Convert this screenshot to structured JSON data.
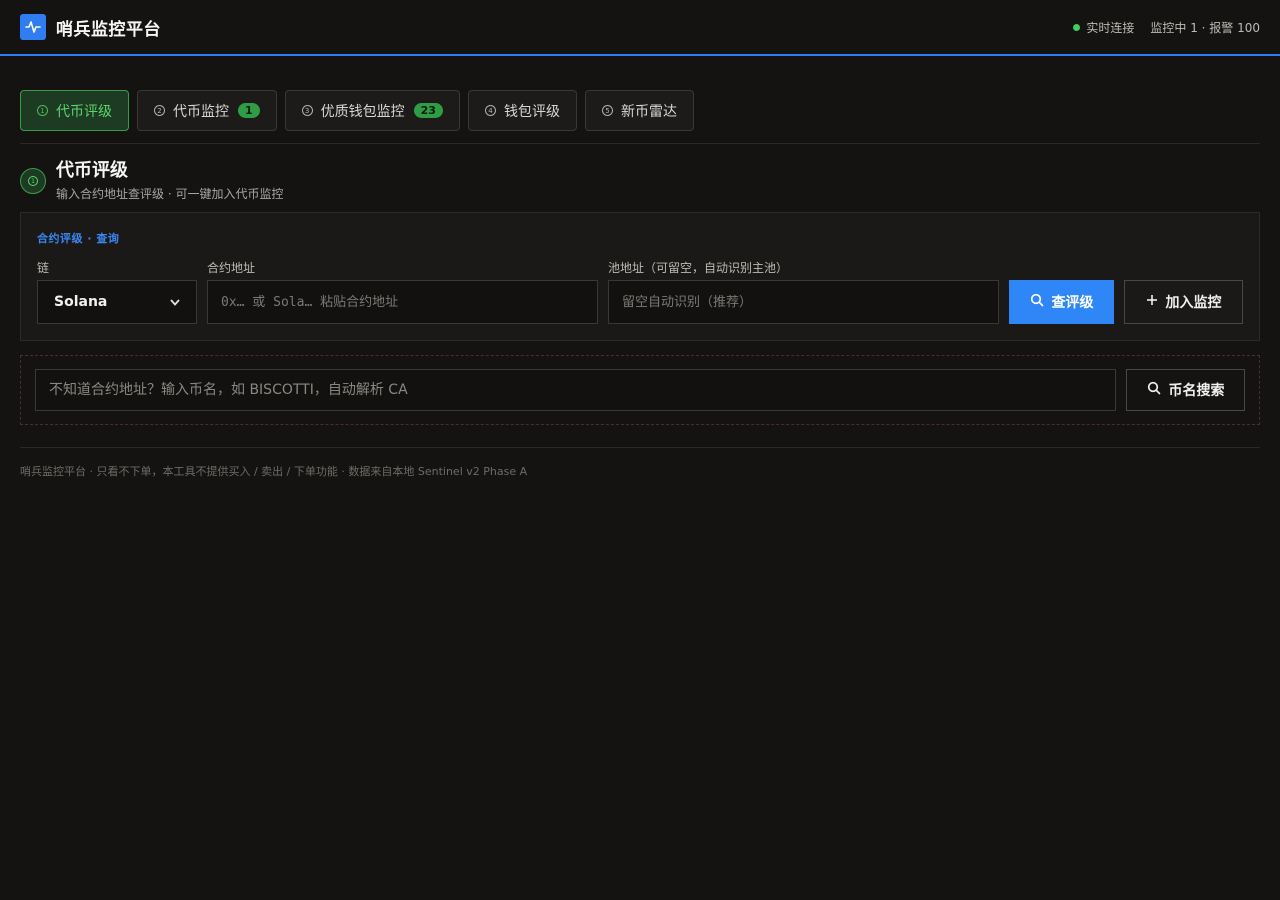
{
  "header": {
    "title": "哨兵监控平台",
    "status_live": "实时连接",
    "status_summary": "监控中 1 · 报警 100"
  },
  "tabs": [
    {
      "num": "①",
      "label": "代币评级",
      "badge": "",
      "active": true
    },
    {
      "num": "②",
      "label": "代币监控",
      "badge": "1",
      "active": false
    },
    {
      "num": "③",
      "label": "优质钱包监控",
      "badge": "23",
      "active": false
    },
    {
      "num": "④",
      "label": "钱包评级",
      "badge": "",
      "active": false
    },
    {
      "num": "⑤",
      "label": "新币雷达",
      "badge": "",
      "active": false
    }
  ],
  "section": {
    "icon_num": "①",
    "title": "代币评级",
    "subtitle": "输入合约地址查评级 · 可一键加入代币监控"
  },
  "query": {
    "crumb": "合约评级 · 查询",
    "chain_label": "链",
    "chain_value": "Solana",
    "contract_label": "合约地址",
    "contract_placeholder": "0x… 或 Sola… 粘贴合约地址",
    "pool_label": "池地址（可留空，自动识别主池）",
    "pool_placeholder": "留空自动识别（推荐）",
    "query_button": "查评级",
    "add_button": "加入监控"
  },
  "name_search": {
    "placeholder": "不知道合约地址？输入币名，如 BISCOTTI，自动解析 CA",
    "button": "币名搜索"
  },
  "footer": "哨兵监控平台 · 只看不下单，本工具不提供买入 / 卖出 / 下单功能 · 数据来自本地 Sentinel v2 Phase A",
  "colors": {
    "accent": "#2f7df0",
    "success": "#3ecf5a",
    "background": "#141312"
  }
}
